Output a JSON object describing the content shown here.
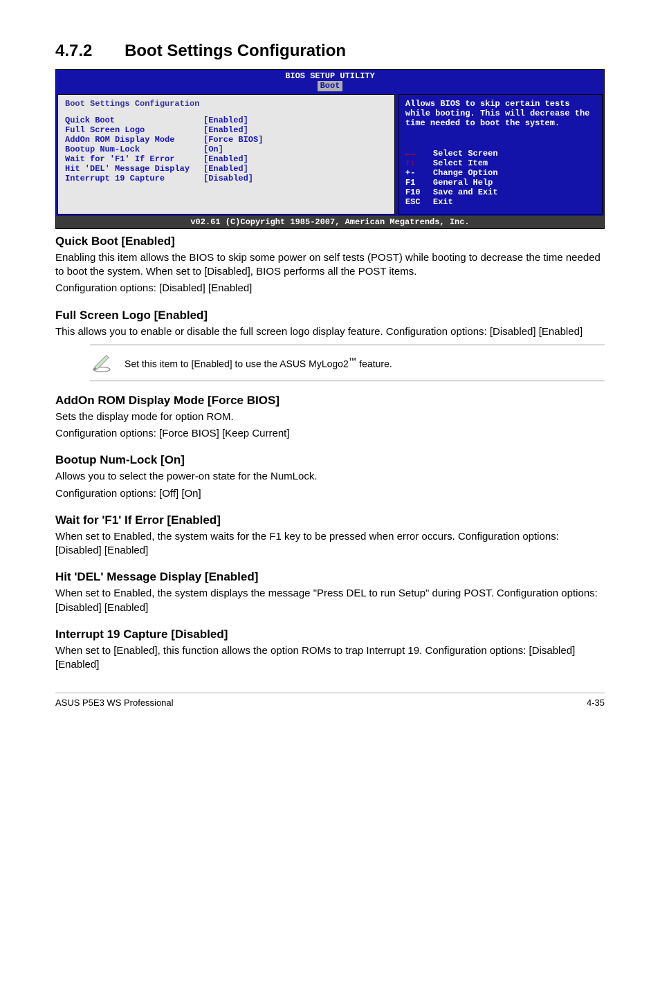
{
  "section": {
    "number": "4.7.2",
    "title": "Boot Settings Configuration"
  },
  "bios": {
    "titlebar_line1": "BIOS SETUP UTILITY",
    "titlebar_tab": "Boot",
    "left_heading": "Boot Settings Configuration",
    "rows": [
      {
        "label": "Quick Boot",
        "value": "[Enabled]"
      },
      {
        "label": "Full Screen Logo",
        "value": "[Enabled]"
      },
      {
        "label": "AddOn ROM Display Mode",
        "value": "[Force BIOS]"
      },
      {
        "label": "Bootup Num-Lock",
        "value": "[On]"
      },
      {
        "label": "Wait for 'F1' If Error",
        "value": "[Enabled]"
      },
      {
        "label": "Hit 'DEL' Message Display",
        "value": "[Enabled]"
      },
      {
        "label": "Interrupt 19 Capture",
        "value": "[Disabled]"
      }
    ],
    "help_text": "Allows BIOS to skip certain tests while booting. This will decrease the time needed to boot the system.",
    "nav": [
      {
        "key": "←→",
        "label": "Select Screen",
        "cls": "nav-arrow-lr"
      },
      {
        "key": "↑↓",
        "label": "Select Item",
        "cls": "nav-arrow-ud"
      },
      {
        "key": "+-",
        "label": "Change Option",
        "cls": ""
      },
      {
        "key": "F1",
        "label": "General Help",
        "cls": ""
      },
      {
        "key": "F10",
        "label": "Save and Exit",
        "cls": ""
      },
      {
        "key": "ESC",
        "label": "Exit",
        "cls": ""
      }
    ],
    "footer": "v02.61 (C)Copyright 1985-2007, American Megatrends, Inc."
  },
  "sections": {
    "quick_boot": {
      "heading": "Quick Boot [Enabled]",
      "body1": "Enabling this item allows the BIOS to skip some power on self tests (POST) while booting to decrease the time needed to boot the system. When set to [Disabled], BIOS performs all the POST items.",
      "body2": "Configuration options: [Disabled] [Enabled]"
    },
    "full_screen": {
      "heading": "Full Screen Logo [Enabled]",
      "body1": "This allows you to enable or disable the full screen logo display feature. Configuration options: [Disabled] [Enabled]"
    },
    "note_prefix": "Set this item to [Enabled] to use the ASUS MyLogo2",
    "note_suffix": " feature.",
    "addon": {
      "heading": "AddOn ROM Display Mode [Force BIOS]",
      "body1": "Sets the display mode for option ROM.",
      "body2": "Configuration options: [Force BIOS] [Keep Current]"
    },
    "bootup": {
      "heading": "Bootup Num-Lock [On]",
      "body1": "Allows you to select the power-on state for the NumLock.",
      "body2": "Configuration options: [Off] [On]"
    },
    "wait_f1": {
      "heading": "Wait for 'F1' If Error [Enabled]",
      "body1": "When set to Enabled, the system waits for the F1 key to be pressed when error occurs. Configuration options: [Disabled] [Enabled]"
    },
    "hit_del": {
      "heading": "Hit 'DEL' Message Display [Enabled]",
      "body1": "When set to Enabled, the system displays the message \"Press DEL to run Setup\" during POST. Configuration options: [Disabled] [Enabled]"
    },
    "interrupt": {
      "heading": "Interrupt 19 Capture [Disabled]",
      "body1": "When set to [Enabled], this function allows the option ROMs to trap Interrupt 19. Configuration options: [Disabled] [Enabled]"
    }
  },
  "footer": {
    "left": "ASUS P5E3 WS Professional",
    "right": "4-35"
  }
}
